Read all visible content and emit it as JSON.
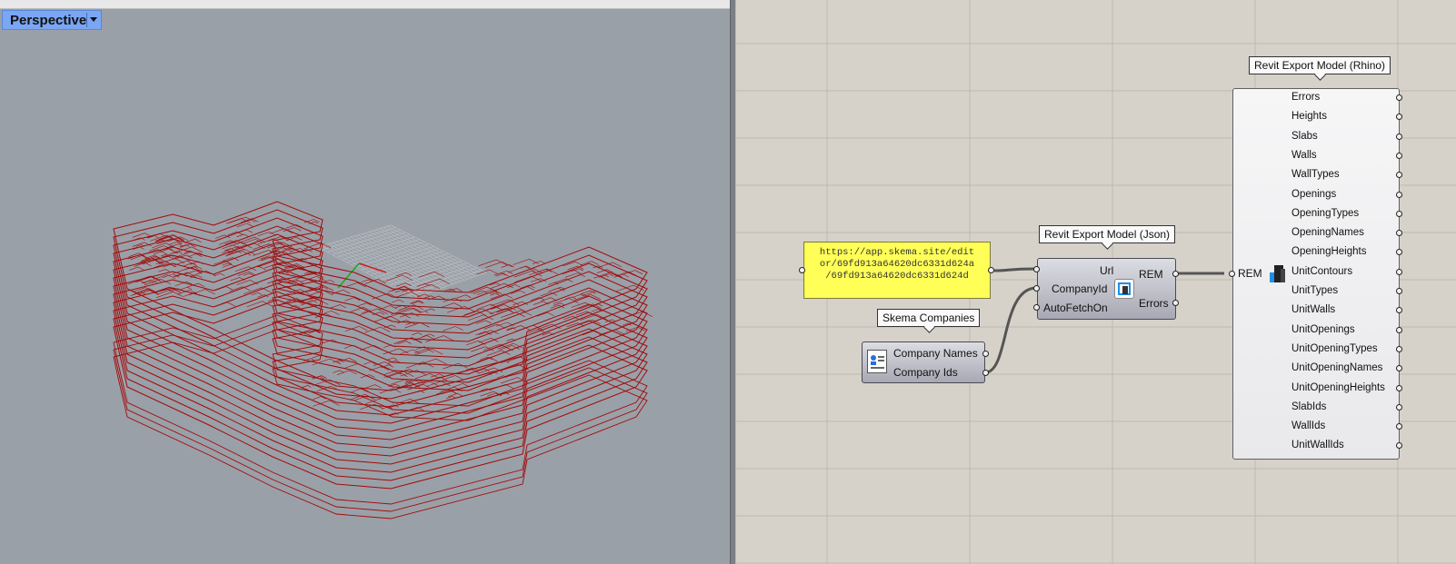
{
  "viewport": {
    "name": "Perspective",
    "colors": {
      "background": "#9aa0a8",
      "wireframe": "#a10a0a",
      "tab": "#7aa6f3"
    }
  },
  "canvas": {
    "url_panel": {
      "text_lines": [
        "https://app.skema.site/edit",
        "or/69fd913a64620dc6331d624a",
        "/69fd913a64620dc6331d624d"
      ]
    },
    "json_component": {
      "tooltip": "Revit Export Model (Json)",
      "inputs": [
        "Url",
        "CompanyId",
        "AutoFetchOn"
      ],
      "outputs": [
        "REM",
        "Errors"
      ]
    },
    "companies_component": {
      "tooltip": "Skema Companies",
      "outputs": [
        "Company Names",
        "Company Ids"
      ]
    },
    "rhino_component": {
      "tooltip": "Revit Export Model (Rhino)",
      "input": "REM",
      "outputs": [
        "Errors",
        "Heights",
        "Slabs",
        "Walls",
        "WallTypes",
        "Openings",
        "OpeningTypes",
        "OpeningNames",
        "OpeningHeights",
        "UnitContours",
        "UnitTypes",
        "UnitWalls",
        "UnitOpenings",
        "UnitOpeningTypes",
        "UnitOpeningNames",
        "UnitOpeningHeights",
        "SlabIds",
        "WallIds",
        "UnitWallIds"
      ]
    },
    "colors": {
      "canvas": "#d6d2c9",
      "panel": "#ffff58",
      "wire": "#555555",
      "icon_blue": "#1e8ee8"
    }
  }
}
